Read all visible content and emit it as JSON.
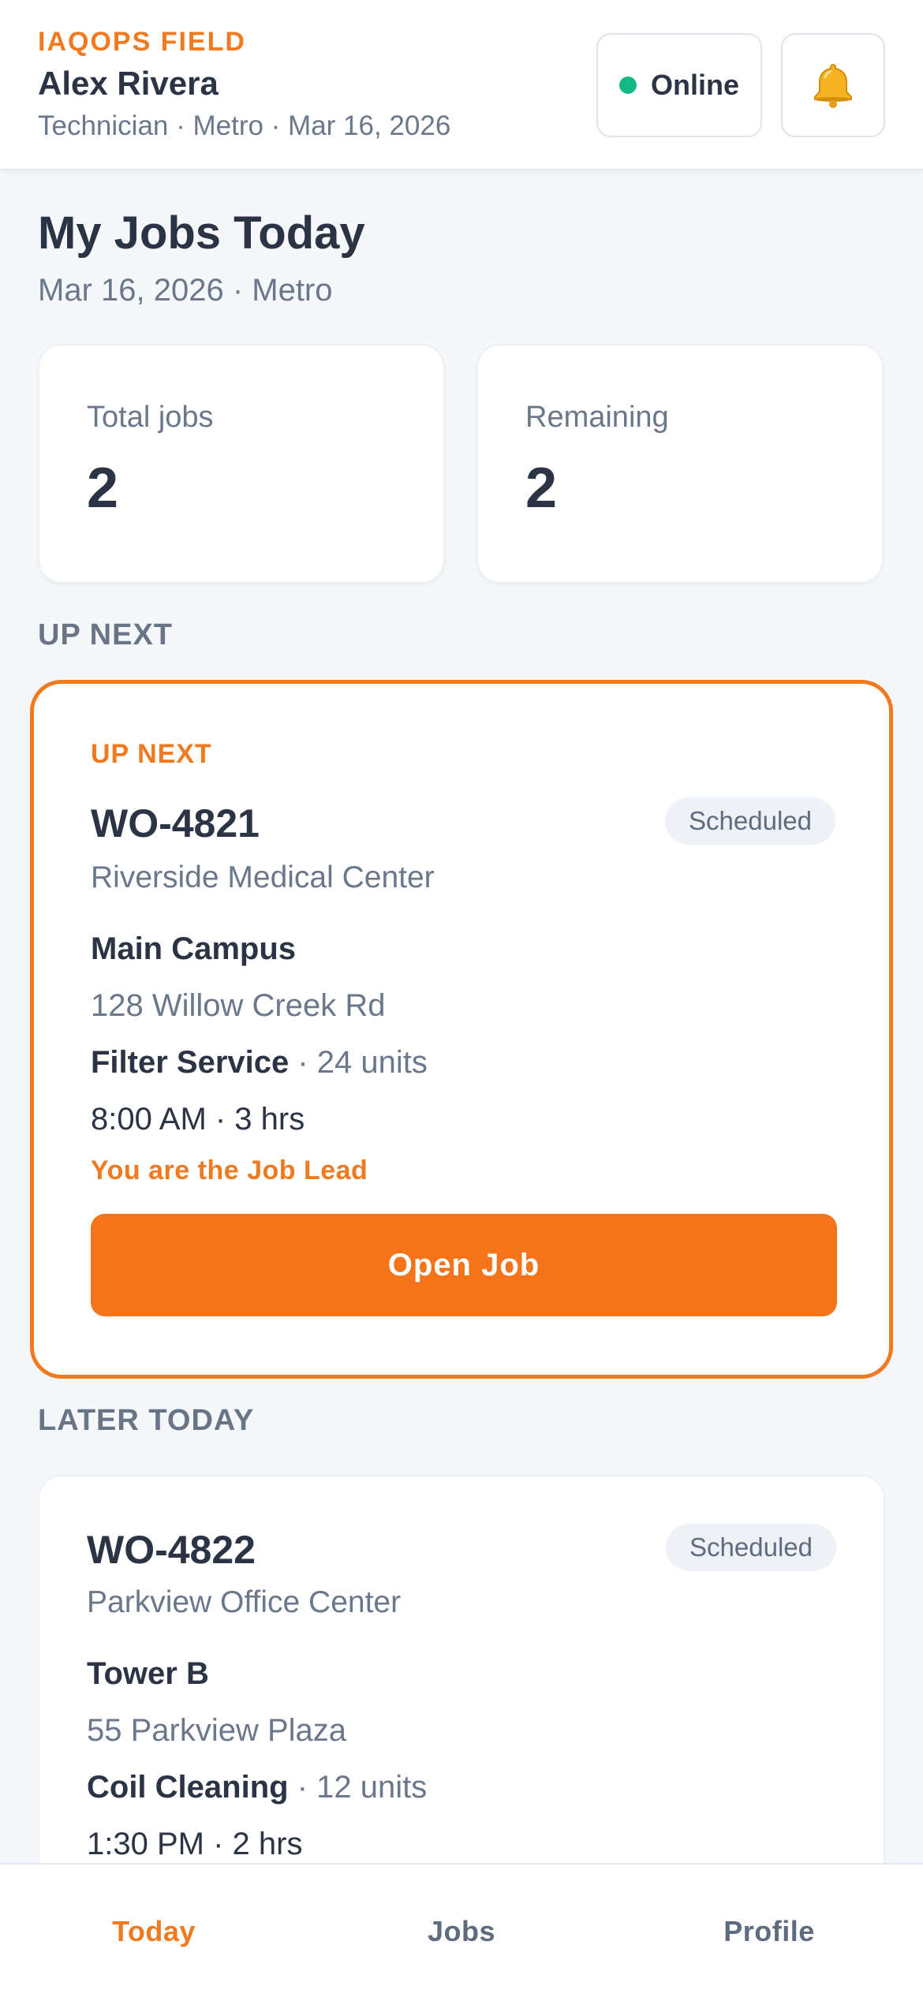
{
  "header": {
    "brand": "IAQOPS FIELD",
    "user_name": "Alex Rivera",
    "user_meta": "Technician · Metro · Mar 16, 2026",
    "status_label": "Online",
    "status_color": "#12b886",
    "bell_icon": "bell-icon"
  },
  "page": {
    "title": "My Jobs Today",
    "subtitle": "Mar 16, 2026 · Metro"
  },
  "stats": {
    "total_label": "Total jobs",
    "total_value": "2",
    "remaining_label": "Remaining",
    "remaining_value": "2"
  },
  "sections": {
    "up_next": "UP NEXT",
    "later_today": "LATER TODAY"
  },
  "jobs": [
    {
      "tag": "UP NEXT",
      "id": "WO-4821",
      "status": "Scheduled",
      "client": "Riverside Medical Center",
      "site": "Main Campus",
      "address": "128 Willow Creek Rd",
      "service": "Filter Service",
      "units": " · 24 units",
      "time": "8:00 AM · 3 hrs",
      "lead_note": "You are the Job Lead",
      "action_label": "Open Job"
    },
    {
      "id": "WO-4822",
      "status": "Scheduled",
      "client": "Parkview Office Center",
      "site": "Tower B",
      "address": "55 Parkview Plaza",
      "service": "Coil Cleaning",
      "units": " · 12 units",
      "time": "1:30 PM · 2 hrs"
    }
  ],
  "nav": {
    "today": "Today",
    "jobs": "Jobs",
    "profile": "Profile"
  },
  "colors": {
    "accent": "#f07a1f",
    "button": "#f57419",
    "online": "#12b886"
  }
}
